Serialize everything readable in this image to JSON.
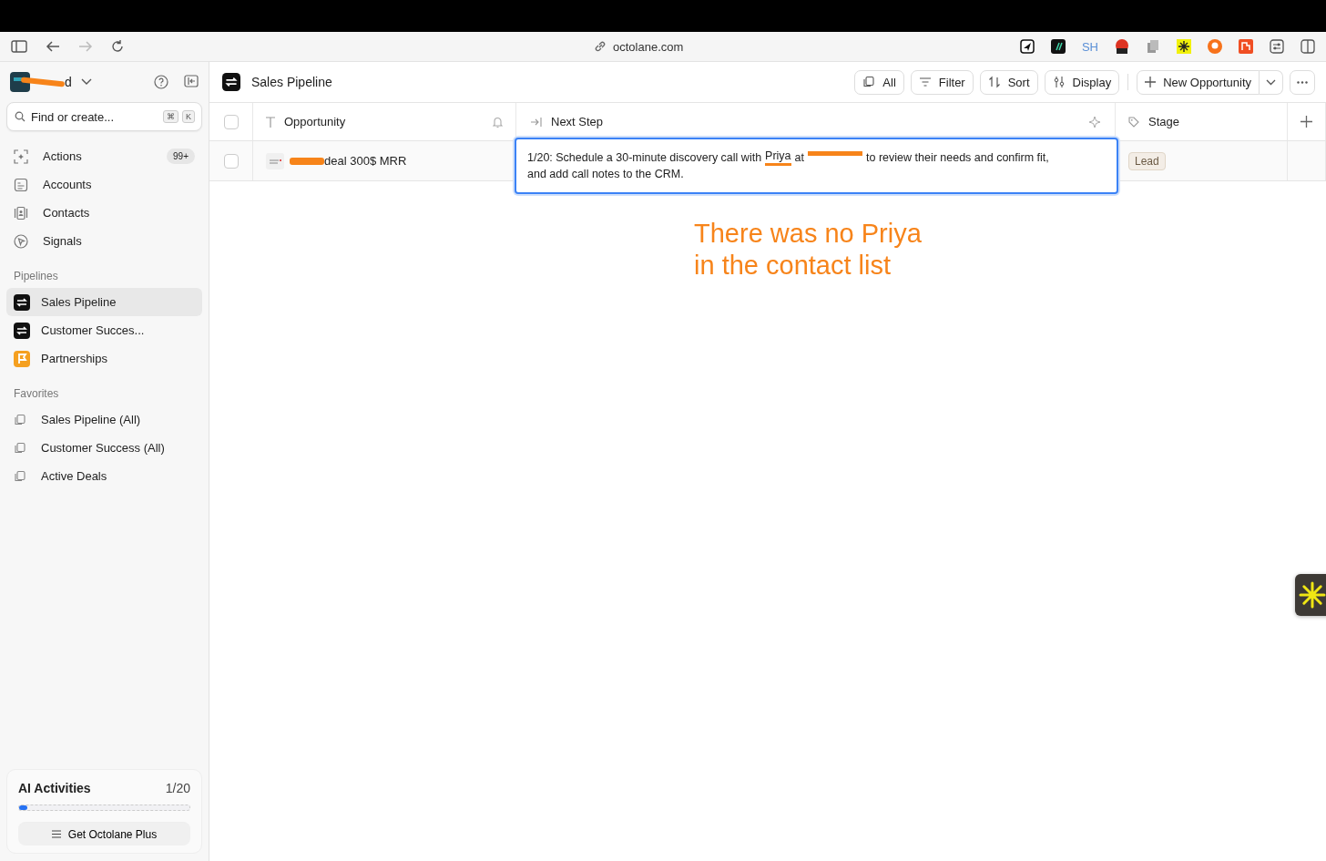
{
  "browser": {
    "url": "octolane.com",
    "extensions": [
      {
        "kind": "send"
      },
      {
        "kind": "slash"
      },
      {
        "kind": "sh",
        "label": "SH"
      },
      {
        "kind": "seo"
      },
      {
        "kind": "copy"
      },
      {
        "kind": "star"
      },
      {
        "kind": "chat"
      },
      {
        "kind": "box"
      },
      {
        "kind": "sliders"
      }
    ]
  },
  "workspace": {
    "name": "d"
  },
  "search": {
    "placeholder": "Find or create...",
    "keys": [
      "⌘",
      "K"
    ]
  },
  "nav": [
    {
      "label": "Actions",
      "kind": "actions",
      "badge": "99+"
    },
    {
      "label": "Accounts",
      "kind": "accounts"
    },
    {
      "label": "Contacts",
      "kind": "contacts"
    },
    {
      "label": "Signals",
      "kind": "signals"
    }
  ],
  "pipelines": {
    "title": "Pipelines",
    "items": [
      {
        "label": "Sales Pipeline",
        "kind": "swap",
        "selected": true
      },
      {
        "label": "Customer Succes...",
        "kind": "swap",
        "selected": false
      },
      {
        "label": "Partnerships",
        "kind": "flag",
        "selected": false
      }
    ]
  },
  "favorites": {
    "title": "Favorites",
    "items": [
      "Sales Pipeline (All)",
      "Customer Success (All)",
      "Active Deals"
    ]
  },
  "ai_activities": {
    "title": "AI Activities",
    "count": "1/20",
    "level": 0.05,
    "button": "Get Octolane Plus"
  },
  "header": {
    "title": "Sales Pipeline",
    "buttons": [
      {
        "label": "All",
        "kind": "views"
      },
      {
        "label": "Filter",
        "kind": "filter"
      },
      {
        "label": "Sort",
        "kind": "sort"
      },
      {
        "label": "Display",
        "kind": "display"
      }
    ],
    "primary": "New Opportunity"
  },
  "table": {
    "select_all_checked": false,
    "columns": [
      {
        "label": "Opportunity",
        "kind": "text"
      },
      {
        "label": "Next Step",
        "kind": "next"
      },
      {
        "label": "Stage",
        "kind": "tag"
      }
    ],
    "rows": [
      {
        "checked": false,
        "opportunity": "deal 300$ MRR",
        "next_step": {
          "before": "1/20: Schedule a 30-minute discovery call with",
          "name": "Priya",
          "at": "at",
          "after": "to review their needs and confirm fit,",
          "line_2": "and add call notes to the CRM."
        },
        "stage": "Lead"
      }
    ]
  },
  "annotation": {
    "lines": [
      "There was no Priya",
      "in the contact list"
    ]
  }
}
